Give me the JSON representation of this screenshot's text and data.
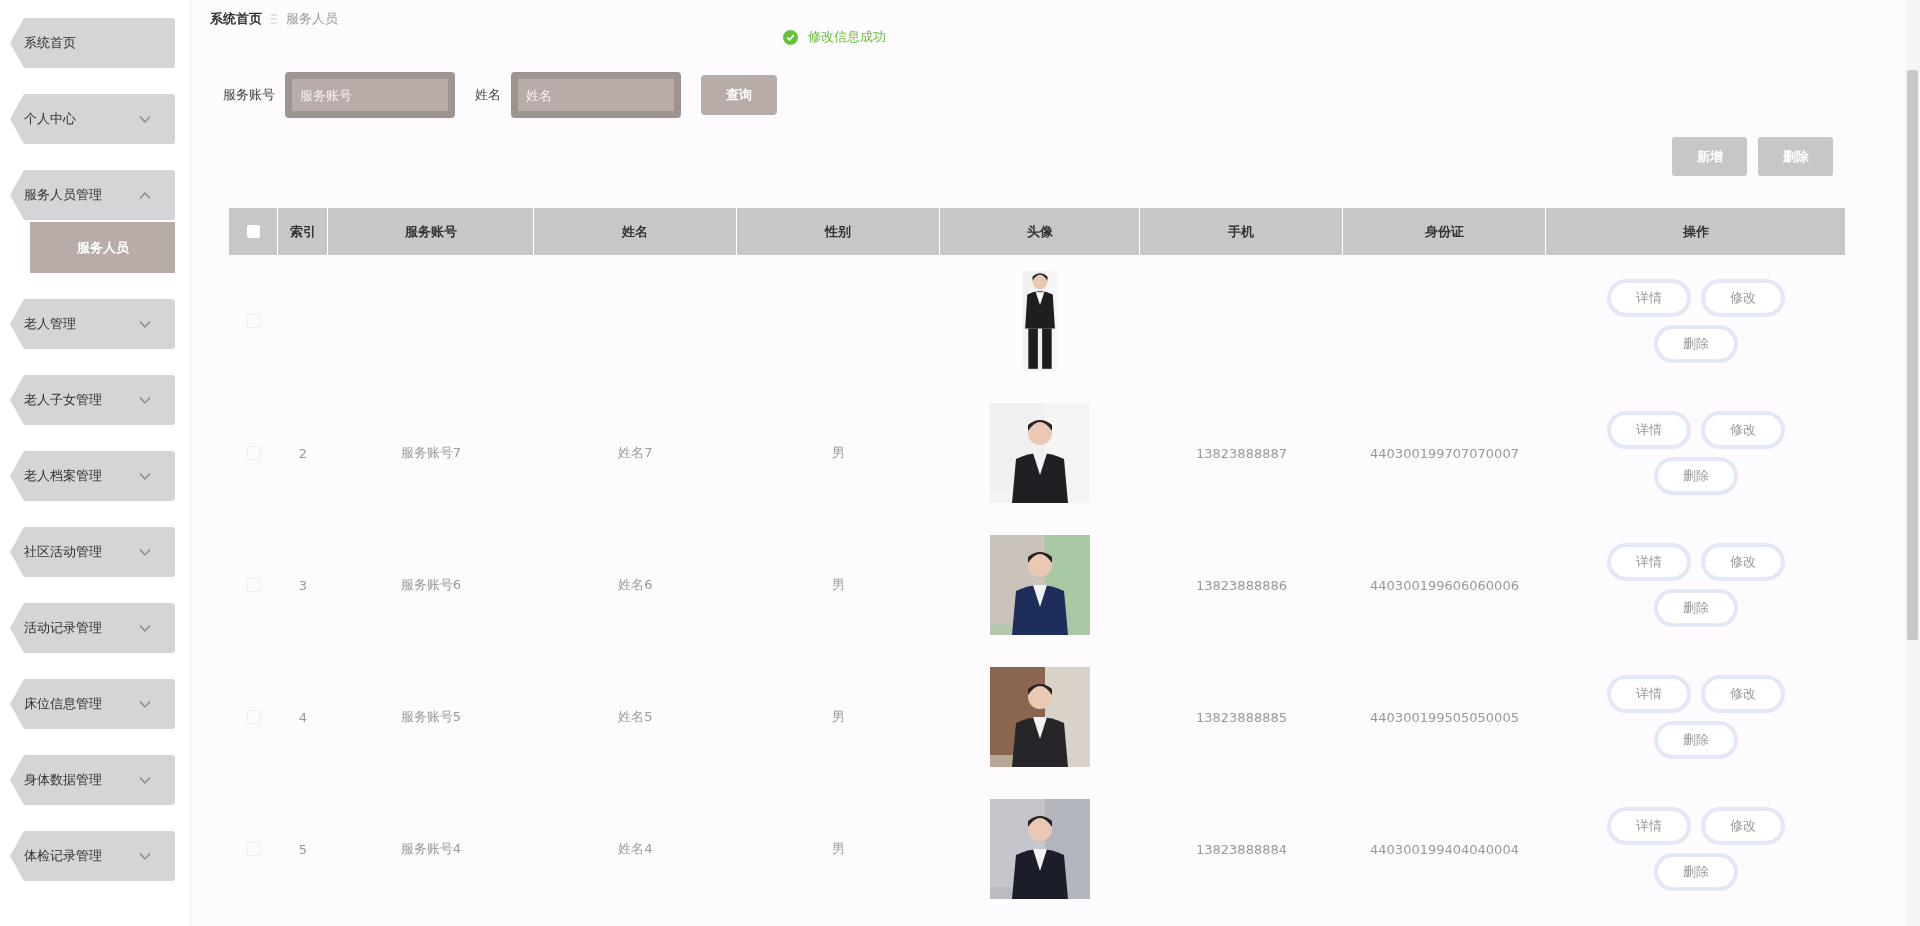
{
  "sidebar": {
    "items": [
      {
        "label": "系统首页",
        "kind": "link"
      },
      {
        "label": "个人中心",
        "kind": "menu",
        "expanded": false
      },
      {
        "label": "服务人员管理",
        "kind": "menu",
        "expanded": true,
        "children": [
          {
            "label": "服务人员",
            "selected": true
          }
        ]
      },
      {
        "label": "老人管理",
        "kind": "menu",
        "expanded": false
      },
      {
        "label": "老人子女管理",
        "kind": "menu",
        "expanded": false
      },
      {
        "label": "老人档案管理",
        "kind": "menu",
        "expanded": false
      },
      {
        "label": "社区活动管理",
        "kind": "menu",
        "expanded": false
      },
      {
        "label": "活动记录管理",
        "kind": "menu",
        "expanded": false
      },
      {
        "label": "床位信息管理",
        "kind": "menu",
        "expanded": false
      },
      {
        "label": "身体数据管理",
        "kind": "menu",
        "expanded": false
      },
      {
        "label": "体检记录管理",
        "kind": "menu",
        "expanded": false
      }
    ]
  },
  "breadcrumb": [
    "系统首页",
    "服务人员"
  ],
  "toast": {
    "text": "修改信息成功"
  },
  "search": {
    "fields": [
      {
        "label": "服务账号",
        "placeholder": "服务账号"
      },
      {
        "label": "姓名",
        "placeholder": "姓名"
      }
    ],
    "button": "查询"
  },
  "actions": [
    "新增",
    "删除"
  ],
  "table": {
    "select_all": {
      "checked": false
    },
    "columns": [
      "索引",
      "服务账号",
      "姓名",
      "性别",
      "头像",
      "手机",
      "身份证",
      "操作"
    ],
    "rows": [
      {
        "checked": false,
        "actions": [
          "详情",
          "修改",
          "删除"
        ]
      },
      {
        "checked": false,
        "index": "2",
        "account": "服务账号7",
        "name": "姓名7",
        "gender": "男",
        "phone": "13823888887",
        "id_card": "440300199707070007",
        "actions": [
          "详情",
          "修改",
          "删除"
        ]
      },
      {
        "checked": false,
        "index": "3",
        "account": "服务账号6",
        "name": "姓名6",
        "gender": "男",
        "phone": "13823888886",
        "id_card": "440300199606060006",
        "actions": [
          "详情",
          "修改",
          "删除"
        ]
      },
      {
        "checked": false,
        "index": "4",
        "account": "服务账号5",
        "name": "姓名5",
        "gender": "男",
        "phone": "13823888885",
        "id_card": "440300199505050005",
        "actions": [
          "详情",
          "修改",
          "删除"
        ]
      },
      {
        "checked": false,
        "index": "5",
        "account": "服务账号4",
        "name": "姓名4",
        "gender": "男",
        "phone": "13823888884",
        "id_card": "440300199404040004",
        "actions": [
          "详情",
          "修改",
          "删除"
        ]
      }
    ]
  }
}
